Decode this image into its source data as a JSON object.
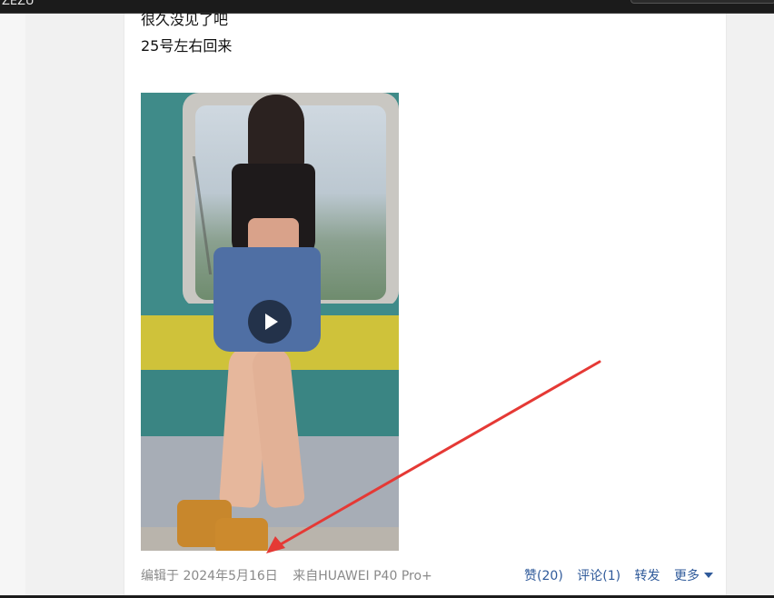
{
  "window": {
    "title": "ZEZU"
  },
  "post": {
    "text_lines": [
      "很久没见了吧",
      "25号左右回来"
    ],
    "video": {
      "alt": "video"
    },
    "meta": {
      "edited": "编辑于 2024年5月16日",
      "source": "来自HUAWEI P40 Pro+"
    },
    "actions": {
      "like": "赞(20)",
      "comment": "评论(1)",
      "repost": "转发",
      "more": "更多"
    }
  },
  "annotation": {
    "arrow_color": "#e53935",
    "icon": "red-arrow-icon"
  },
  "colors": {
    "link": "#2f5a9a",
    "meta": "#8a8a8a"
  }
}
